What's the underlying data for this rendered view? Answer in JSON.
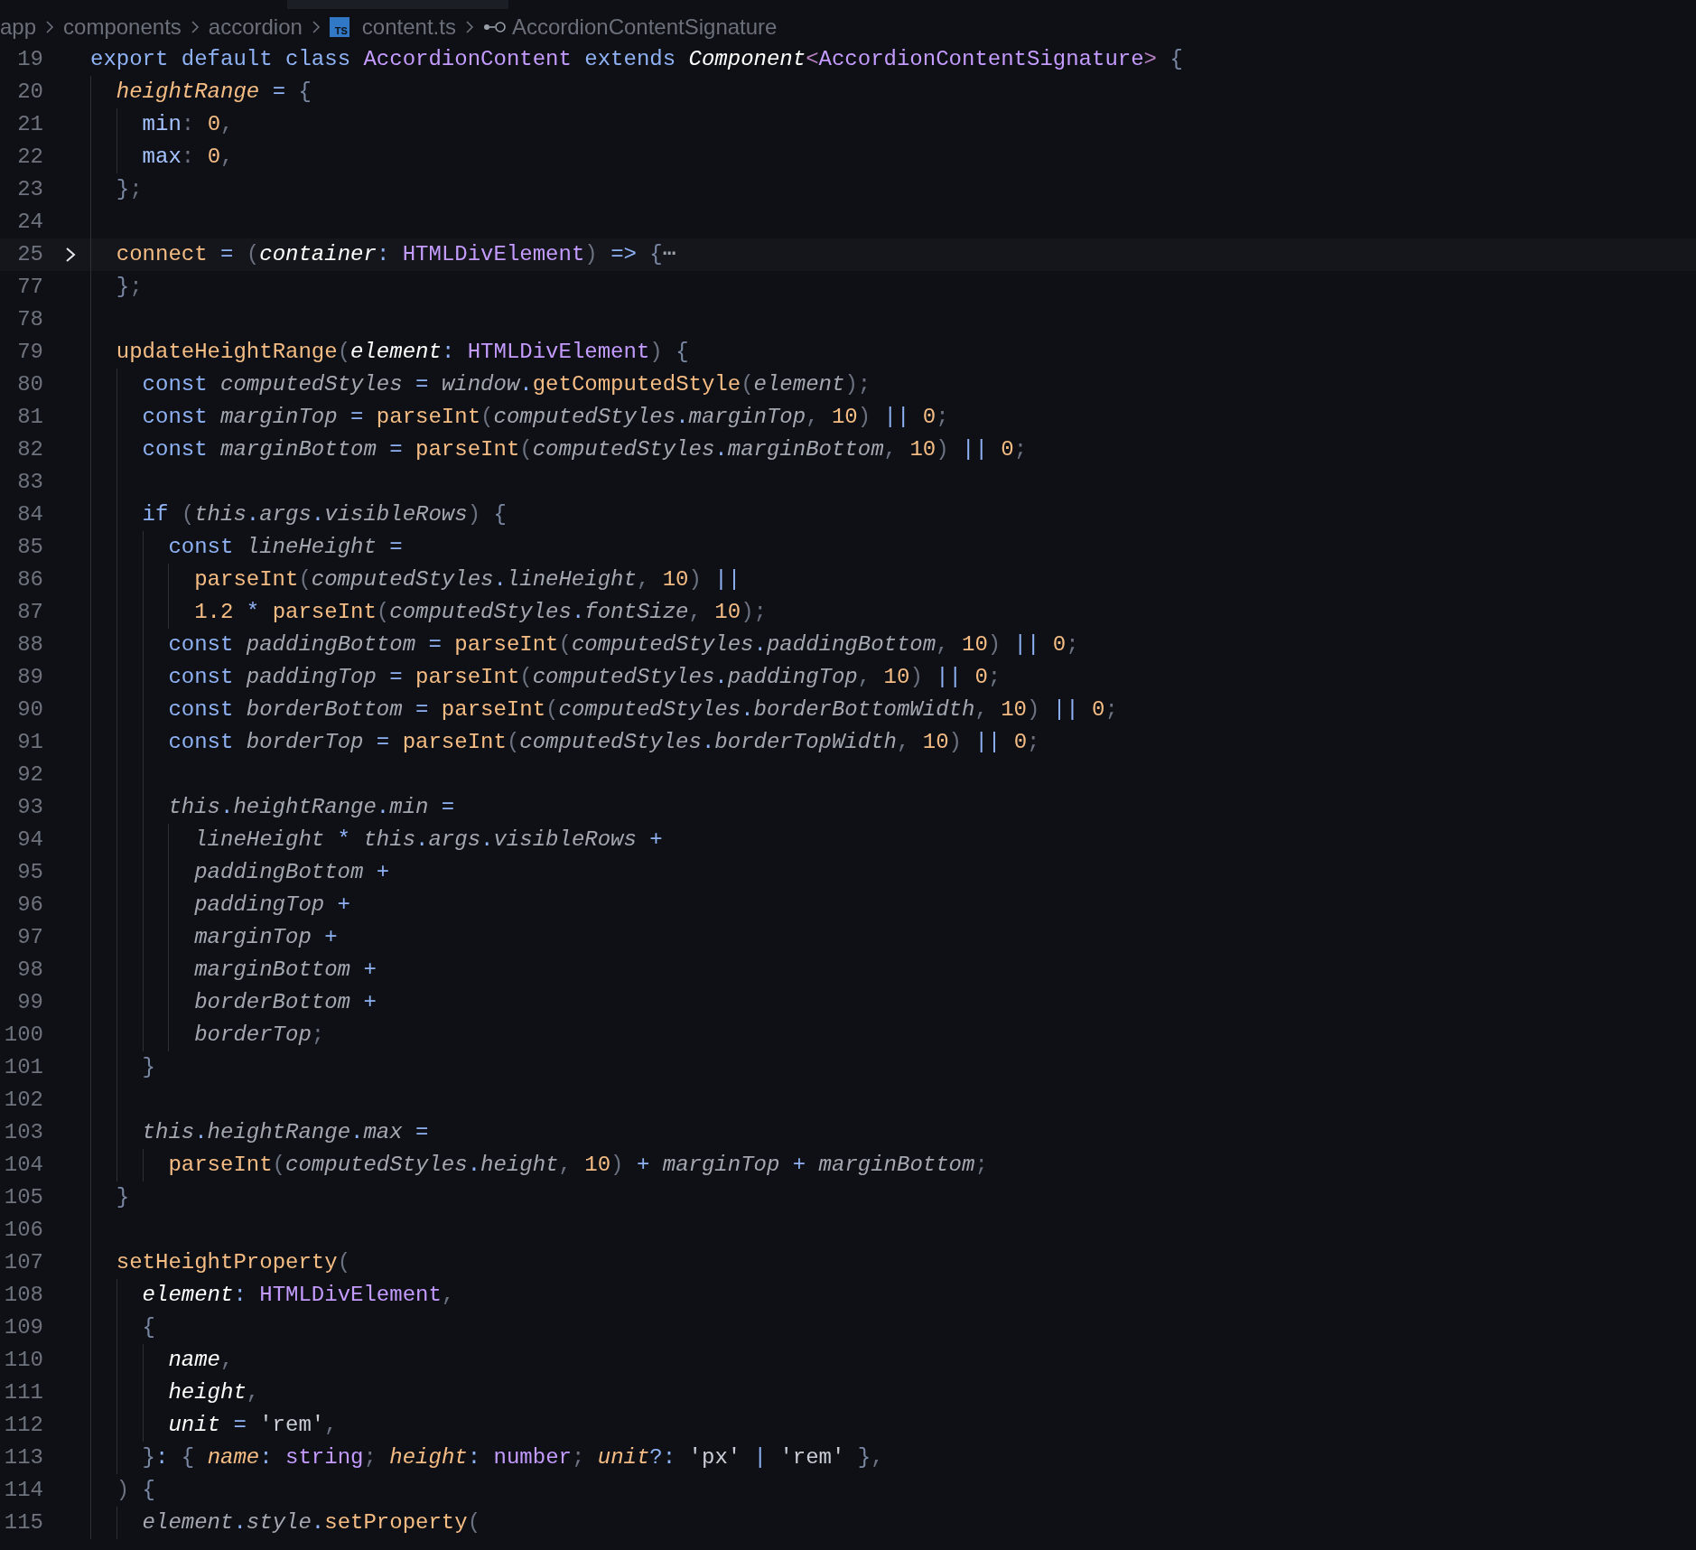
{
  "breadcrumb": [
    {
      "kind": "folder",
      "label": "app"
    },
    {
      "kind": "folder",
      "label": "components"
    },
    {
      "kind": "folder",
      "label": "accordion"
    },
    {
      "kind": "file",
      "badge": "TS",
      "label": "content.ts"
    },
    {
      "kind": "symbol",
      "label": "AccordionContentSignature"
    }
  ],
  "lines": [
    {
      "number": "19",
      "folded": false,
      "tokens": [
        {
          "kind": "kw",
          "text": "export default class "
        },
        {
          "kind": "type",
          "text": "AccordionContent"
        },
        {
          "kind": "kw",
          "text": " extends "
        },
        {
          "kind": "param",
          "text": "Component"
        },
        {
          "kind": "angle",
          "text": "<"
        },
        {
          "kind": "type",
          "text": "AccordionContentSignature"
        },
        {
          "kind": "angle",
          "text": ">"
        },
        {
          "kind": "brace",
          "text": " {"
        }
      ]
    },
    {
      "number": "20",
      "folded": false,
      "tokens": [
        {
          "kind": "iprop",
          "text": "  heightRange"
        },
        {
          "kind": "op",
          "text": " = "
        },
        {
          "kind": "brace",
          "text": "{"
        }
      ]
    },
    {
      "number": "21",
      "folded": false,
      "tokens": [
        {
          "kind": "prop",
          "text": "    min"
        },
        {
          "kind": "punct",
          "text": ": "
        },
        {
          "kind": "num",
          "text": "0"
        },
        {
          "kind": "punct",
          "text": ","
        }
      ]
    },
    {
      "number": "22",
      "folded": false,
      "tokens": [
        {
          "kind": "prop",
          "text": "    max"
        },
        {
          "kind": "punct",
          "text": ": "
        },
        {
          "kind": "num",
          "text": "0"
        },
        {
          "kind": "punct",
          "text": ","
        }
      ]
    },
    {
      "number": "23",
      "folded": false,
      "tokens": [
        {
          "kind": "brace",
          "text": "  }"
        },
        {
          "kind": "punct",
          "text": ";"
        }
      ]
    },
    {
      "number": "24",
      "folded": false
    },
    {
      "number": "25",
      "folded": true,
      "tokens": [
        {
          "kind": "fn",
          "text": "  connect"
        },
        {
          "kind": "op",
          "text": " = "
        },
        {
          "kind": "punct",
          "text": "("
        },
        {
          "kind": "param",
          "text": "container"
        },
        {
          "kind": "op",
          "text": ": "
        },
        {
          "kind": "type",
          "text": "HTMLDivElement"
        },
        {
          "kind": "punct",
          "text": ")"
        },
        {
          "kind": "op",
          "text": " => "
        },
        {
          "kind": "brace",
          "text": "{"
        },
        {
          "kind": "ellipsis",
          "text": "⋯"
        }
      ]
    },
    {
      "number": "77",
      "folded": false,
      "tokens": [
        {
          "kind": "brace",
          "text": "  }"
        },
        {
          "kind": "punct",
          "text": ";"
        }
      ]
    },
    {
      "number": "78",
      "folded": false
    },
    {
      "number": "79",
      "folded": false,
      "tokens": [
        {
          "kind": "fn",
          "text": "  updateHeightRange"
        },
        {
          "kind": "punct",
          "text": "("
        },
        {
          "kind": "param",
          "text": "element"
        },
        {
          "kind": "op",
          "text": ": "
        },
        {
          "kind": "type",
          "text": "HTMLDivElement"
        },
        {
          "kind": "punct",
          "text": ")"
        },
        {
          "kind": "brace",
          "text": " {"
        }
      ]
    },
    {
      "number": "80",
      "folded": false,
      "tokens": [
        {
          "kind": "kw",
          "text": "    const "
        },
        {
          "kind": "var",
          "text": "computedStyles"
        },
        {
          "kind": "op",
          "text": " = "
        },
        {
          "kind": "var",
          "text": "window"
        },
        {
          "kind": "op",
          "text": "."
        },
        {
          "kind": "fn",
          "text": "getComputedStyle"
        },
        {
          "kind": "punct",
          "text": "("
        },
        {
          "kind": "var",
          "text": "element"
        },
        {
          "kind": "punct",
          "text": ");"
        }
      ]
    },
    {
      "number": "81",
      "folded": false,
      "tokens": [
        {
          "kind": "kw",
          "text": "    const "
        },
        {
          "kind": "var",
          "text": "marginTop"
        },
        {
          "kind": "op",
          "text": " = "
        },
        {
          "kind": "fn",
          "text": "parseInt"
        },
        {
          "kind": "punct",
          "text": "("
        },
        {
          "kind": "var",
          "text": "computedStyles"
        },
        {
          "kind": "op",
          "text": "."
        },
        {
          "kind": "var",
          "text": "marginTop"
        },
        {
          "kind": "punct",
          "text": ", "
        },
        {
          "kind": "num",
          "text": "10"
        },
        {
          "kind": "punct",
          "text": ") "
        },
        {
          "kind": "op",
          "text": "|| "
        },
        {
          "kind": "num",
          "text": "0"
        },
        {
          "kind": "punct",
          "text": ";"
        }
      ]
    },
    {
      "number": "82",
      "folded": false,
      "tokens": [
        {
          "kind": "kw",
          "text": "    const "
        },
        {
          "kind": "var",
          "text": "marginBottom"
        },
        {
          "kind": "op",
          "text": " = "
        },
        {
          "kind": "fn",
          "text": "parseInt"
        },
        {
          "kind": "punct",
          "text": "("
        },
        {
          "kind": "var",
          "text": "computedStyles"
        },
        {
          "kind": "op",
          "text": "."
        },
        {
          "kind": "var",
          "text": "marginBottom"
        },
        {
          "kind": "punct",
          "text": ", "
        },
        {
          "kind": "num",
          "text": "10"
        },
        {
          "kind": "punct",
          "text": ") "
        },
        {
          "kind": "op",
          "text": "|| "
        },
        {
          "kind": "num",
          "text": "0"
        },
        {
          "kind": "punct",
          "text": ";"
        }
      ]
    },
    {
      "number": "83",
      "folded": false
    },
    {
      "number": "84",
      "folded": false,
      "tokens": [
        {
          "kind": "kw",
          "text": "    if "
        },
        {
          "kind": "punct",
          "text": "("
        },
        {
          "kind": "var",
          "text": "this"
        },
        {
          "kind": "op",
          "text": "."
        },
        {
          "kind": "var",
          "text": "args"
        },
        {
          "kind": "op",
          "text": "."
        },
        {
          "kind": "var",
          "text": "visibleRows"
        },
        {
          "kind": "punct",
          "text": ") "
        },
        {
          "kind": "brace",
          "text": "{"
        }
      ]
    },
    {
      "number": "85",
      "folded": false,
      "tokens": [
        {
          "kind": "kw",
          "text": "      const "
        },
        {
          "kind": "var",
          "text": "lineHeight"
        },
        {
          "kind": "op",
          "text": " ="
        }
      ]
    },
    {
      "number": "86",
      "folded": false,
      "tokens": [
        {
          "kind": "fn",
          "text": "        parseInt"
        },
        {
          "kind": "punct",
          "text": "("
        },
        {
          "kind": "var",
          "text": "computedStyles"
        },
        {
          "kind": "op",
          "text": "."
        },
        {
          "kind": "var",
          "text": "lineHeight"
        },
        {
          "kind": "punct",
          "text": ", "
        },
        {
          "kind": "num",
          "text": "10"
        },
        {
          "kind": "punct",
          "text": ") "
        },
        {
          "kind": "op",
          "text": "||"
        }
      ]
    },
    {
      "number": "87",
      "folded": false,
      "tokens": [
        {
          "kind": "num",
          "text": "        1.2"
        },
        {
          "kind": "op",
          "text": " * "
        },
        {
          "kind": "fn",
          "text": "parseInt"
        },
        {
          "kind": "punct",
          "text": "("
        },
        {
          "kind": "var",
          "text": "computedStyles"
        },
        {
          "kind": "op",
          "text": "."
        },
        {
          "kind": "var",
          "text": "fontSize"
        },
        {
          "kind": "punct",
          "text": ", "
        },
        {
          "kind": "num",
          "text": "10"
        },
        {
          "kind": "punct",
          "text": ");"
        }
      ]
    },
    {
      "number": "88",
      "folded": false,
      "tokens": [
        {
          "kind": "kw",
          "text": "      const "
        },
        {
          "kind": "var",
          "text": "paddingBottom"
        },
        {
          "kind": "op",
          "text": " = "
        },
        {
          "kind": "fn",
          "text": "parseInt"
        },
        {
          "kind": "punct",
          "text": "("
        },
        {
          "kind": "var",
          "text": "computedStyles"
        },
        {
          "kind": "op",
          "text": "."
        },
        {
          "kind": "var",
          "text": "paddingBottom"
        },
        {
          "kind": "punct",
          "text": ", "
        },
        {
          "kind": "num",
          "text": "10"
        },
        {
          "kind": "punct",
          "text": ") "
        },
        {
          "kind": "op",
          "text": "|| "
        },
        {
          "kind": "num",
          "text": "0"
        },
        {
          "kind": "punct",
          "text": ";"
        }
      ]
    },
    {
      "number": "89",
      "folded": false,
      "tokens": [
        {
          "kind": "kw",
          "text": "      const "
        },
        {
          "kind": "var",
          "text": "paddingTop"
        },
        {
          "kind": "op",
          "text": " = "
        },
        {
          "kind": "fn",
          "text": "parseInt"
        },
        {
          "kind": "punct",
          "text": "("
        },
        {
          "kind": "var",
          "text": "computedStyles"
        },
        {
          "kind": "op",
          "text": "."
        },
        {
          "kind": "var",
          "text": "paddingTop"
        },
        {
          "kind": "punct",
          "text": ", "
        },
        {
          "kind": "num",
          "text": "10"
        },
        {
          "kind": "punct",
          "text": ") "
        },
        {
          "kind": "op",
          "text": "|| "
        },
        {
          "kind": "num",
          "text": "0"
        },
        {
          "kind": "punct",
          "text": ";"
        }
      ]
    },
    {
      "number": "90",
      "folded": false,
      "tokens": [
        {
          "kind": "kw",
          "text": "      const "
        },
        {
          "kind": "var",
          "text": "borderBottom"
        },
        {
          "kind": "op",
          "text": " = "
        },
        {
          "kind": "fn",
          "text": "parseInt"
        },
        {
          "kind": "punct",
          "text": "("
        },
        {
          "kind": "var",
          "text": "computedStyles"
        },
        {
          "kind": "op",
          "text": "."
        },
        {
          "kind": "var",
          "text": "borderBottomWidth"
        },
        {
          "kind": "punct",
          "text": ", "
        },
        {
          "kind": "num",
          "text": "10"
        },
        {
          "kind": "punct",
          "text": ") "
        },
        {
          "kind": "op",
          "text": "|| "
        },
        {
          "kind": "num",
          "text": "0"
        },
        {
          "kind": "punct",
          "text": ";"
        }
      ]
    },
    {
      "number": "91",
      "folded": false,
      "tokens": [
        {
          "kind": "kw",
          "text": "      const "
        },
        {
          "kind": "var",
          "text": "borderTop"
        },
        {
          "kind": "op",
          "text": " = "
        },
        {
          "kind": "fn",
          "text": "parseInt"
        },
        {
          "kind": "punct",
          "text": "("
        },
        {
          "kind": "var",
          "text": "computedStyles"
        },
        {
          "kind": "op",
          "text": "."
        },
        {
          "kind": "var",
          "text": "borderTopWidth"
        },
        {
          "kind": "punct",
          "text": ", "
        },
        {
          "kind": "num",
          "text": "10"
        },
        {
          "kind": "punct",
          "text": ") "
        },
        {
          "kind": "op",
          "text": "|| "
        },
        {
          "kind": "num",
          "text": "0"
        },
        {
          "kind": "punct",
          "text": ";"
        }
      ]
    },
    {
      "number": "92",
      "folded": false
    },
    {
      "number": "93",
      "folded": false,
      "tokens": [
        {
          "kind": "var",
          "text": "      this"
        },
        {
          "kind": "op",
          "text": "."
        },
        {
          "kind": "var",
          "text": "heightRange"
        },
        {
          "kind": "op",
          "text": "."
        },
        {
          "kind": "var",
          "text": "min"
        },
        {
          "kind": "op",
          "text": " ="
        }
      ]
    },
    {
      "number": "94",
      "folded": false,
      "tokens": [
        {
          "kind": "var",
          "text": "        lineHeight"
        },
        {
          "kind": "op",
          "text": " * "
        },
        {
          "kind": "var",
          "text": "this"
        },
        {
          "kind": "op",
          "text": "."
        },
        {
          "kind": "var",
          "text": "args"
        },
        {
          "kind": "op",
          "text": "."
        },
        {
          "kind": "var",
          "text": "visibleRows"
        },
        {
          "kind": "op",
          "text": " +"
        }
      ]
    },
    {
      "number": "95",
      "folded": false,
      "tokens": [
        {
          "kind": "var",
          "text": "        paddingBottom"
        },
        {
          "kind": "op",
          "text": " +"
        }
      ]
    },
    {
      "number": "96",
      "folded": false,
      "tokens": [
        {
          "kind": "var",
          "text": "        paddingTop"
        },
        {
          "kind": "op",
          "text": " +"
        }
      ]
    },
    {
      "number": "97",
      "folded": false,
      "tokens": [
        {
          "kind": "var",
          "text": "        marginTop"
        },
        {
          "kind": "op",
          "text": " +"
        }
      ]
    },
    {
      "number": "98",
      "folded": false,
      "tokens": [
        {
          "kind": "var",
          "text": "        marginBottom"
        },
        {
          "kind": "op",
          "text": " +"
        }
      ]
    },
    {
      "number": "99",
      "folded": false,
      "tokens": [
        {
          "kind": "var",
          "text": "        borderBottom"
        },
        {
          "kind": "op",
          "text": " +"
        }
      ]
    },
    {
      "number": "100",
      "folded": false,
      "tokens": [
        {
          "kind": "var",
          "text": "        borderTop"
        },
        {
          "kind": "punct",
          "text": ";"
        }
      ]
    },
    {
      "number": "101",
      "folded": false,
      "tokens": [
        {
          "kind": "brace",
          "text": "    }"
        }
      ]
    },
    {
      "number": "102",
      "folded": false
    },
    {
      "number": "103",
      "folded": false,
      "tokens": [
        {
          "kind": "var",
          "text": "    this"
        },
        {
          "kind": "op",
          "text": "."
        },
        {
          "kind": "var",
          "text": "heightRange"
        },
        {
          "kind": "op",
          "text": "."
        },
        {
          "kind": "var",
          "text": "max"
        },
        {
          "kind": "op",
          "text": " ="
        }
      ]
    },
    {
      "number": "104",
      "folded": false,
      "tokens": [
        {
          "kind": "fn",
          "text": "      parseInt"
        },
        {
          "kind": "punct",
          "text": "("
        },
        {
          "kind": "var",
          "text": "computedStyles"
        },
        {
          "kind": "op",
          "text": "."
        },
        {
          "kind": "var",
          "text": "height"
        },
        {
          "kind": "punct",
          "text": ", "
        },
        {
          "kind": "num",
          "text": "10"
        },
        {
          "kind": "punct",
          "text": ") "
        },
        {
          "kind": "op",
          "text": "+ "
        },
        {
          "kind": "var",
          "text": "marginTop"
        },
        {
          "kind": "op",
          "text": " + "
        },
        {
          "kind": "var",
          "text": "marginBottom"
        },
        {
          "kind": "punct",
          "text": ";"
        }
      ]
    },
    {
      "number": "105",
      "folded": false,
      "tokens": [
        {
          "kind": "brace",
          "text": "  }"
        }
      ]
    },
    {
      "number": "106",
      "folded": false
    },
    {
      "number": "107",
      "folded": false,
      "tokens": [
        {
          "kind": "fn",
          "text": "  setHeightProperty"
        },
        {
          "kind": "punct",
          "text": "("
        }
      ]
    },
    {
      "number": "108",
      "folded": false,
      "tokens": [
        {
          "kind": "param",
          "text": "    element"
        },
        {
          "kind": "op",
          "text": ": "
        },
        {
          "kind": "type",
          "text": "HTMLDivElement"
        },
        {
          "kind": "punct",
          "text": ","
        }
      ]
    },
    {
      "number": "109",
      "folded": false,
      "tokens": [
        {
          "kind": "brace",
          "text": "    {"
        }
      ]
    },
    {
      "number": "110",
      "folded": false,
      "tokens": [
        {
          "kind": "param",
          "text": "      name"
        },
        {
          "kind": "punct",
          "text": ","
        }
      ]
    },
    {
      "number": "111",
      "folded": false,
      "tokens": [
        {
          "kind": "param",
          "text": "      height"
        },
        {
          "kind": "punct",
          "text": ","
        }
      ]
    },
    {
      "number": "112",
      "folded": false,
      "tokens": [
        {
          "kind": "param",
          "text": "      unit"
        },
        {
          "kind": "op",
          "text": " = "
        },
        {
          "kind": "str",
          "text": "'rem'"
        },
        {
          "kind": "punct",
          "text": ","
        }
      ]
    },
    {
      "number": "113",
      "folded": false,
      "tokens": [
        {
          "kind": "brace",
          "text": "    }"
        },
        {
          "kind": "op",
          "text": ": "
        },
        {
          "kind": "brace",
          "text": "{ "
        },
        {
          "kind": "iprop",
          "text": "name"
        },
        {
          "kind": "op",
          "text": ": "
        },
        {
          "kind": "type",
          "text": "string"
        },
        {
          "kind": "punct",
          "text": "; "
        },
        {
          "kind": "iprop",
          "text": "height"
        },
        {
          "kind": "op",
          "text": ": "
        },
        {
          "kind": "type",
          "text": "number"
        },
        {
          "kind": "punct",
          "text": "; "
        },
        {
          "kind": "iprop",
          "text": "unit"
        },
        {
          "kind": "op",
          "text": "?: "
        },
        {
          "kind": "str",
          "text": "'px'"
        },
        {
          "kind": "op",
          "text": " | "
        },
        {
          "kind": "str",
          "text": "'rem'"
        },
        {
          "kind": "brace",
          "text": " }"
        },
        {
          "kind": "punct",
          "text": ","
        }
      ]
    },
    {
      "number": "114",
      "folded": false,
      "tokens": [
        {
          "kind": "punct",
          "text": "  ) "
        },
        {
          "kind": "brace",
          "text": "{"
        }
      ]
    },
    {
      "number": "115",
      "folded": false,
      "tokens": [
        {
          "kind": "var",
          "text": "    element"
        },
        {
          "kind": "op",
          "text": "."
        },
        {
          "kind": "var",
          "text": "style"
        },
        {
          "kind": "op",
          "text": "."
        },
        {
          "kind": "fn",
          "text": "setProperty"
        },
        {
          "kind": "punct",
          "text": "("
        }
      ]
    }
  ]
}
